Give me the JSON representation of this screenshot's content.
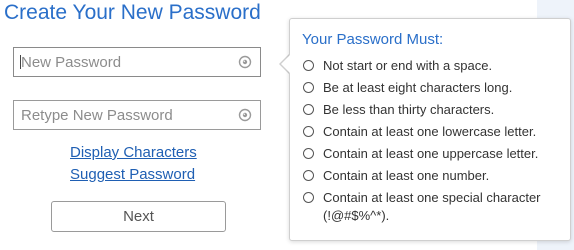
{
  "page": {
    "title": "Create Your New Password"
  },
  "form": {
    "new_password_placeholder": "New Password",
    "retype_password_placeholder": "Retype New Password",
    "display_characters_link": "Display Characters",
    "suggest_password_link": "Suggest Password",
    "next_button": "Next"
  },
  "requirements": {
    "title": "Your Password Must:",
    "items": [
      {
        "text": "Not start or end with a space."
      },
      {
        "text": "Be at least eight characters long."
      },
      {
        "text": "Be less than thirty characters."
      },
      {
        "text": "Contain at least one lowercase letter."
      },
      {
        "text": "Contain at least one uppercase letter."
      },
      {
        "text": "Contain at least one number."
      },
      {
        "text": "Contain at least one special character",
        "text_line2": "(!@#$%^*)."
      }
    ]
  },
  "colors": {
    "accent": "#2a6fc9",
    "link": "#1f5fb3"
  },
  "icons": {
    "field_visibility": "eye-icon",
    "requirement_status": "circle-icon"
  }
}
